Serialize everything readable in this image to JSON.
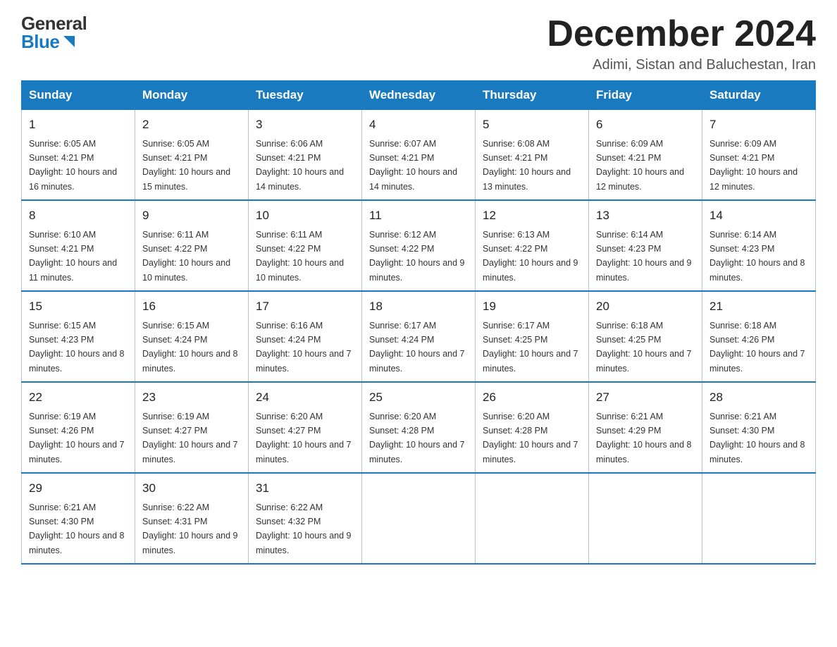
{
  "header": {
    "logo_general": "General",
    "logo_blue": "Blue",
    "month_title": "December 2024",
    "subtitle": "Adimi, Sistan and Baluchestan, Iran"
  },
  "days_of_week": [
    "Sunday",
    "Monday",
    "Tuesday",
    "Wednesday",
    "Thursday",
    "Friday",
    "Saturday"
  ],
  "weeks": [
    [
      {
        "day": "1",
        "sunrise": "6:05 AM",
        "sunset": "4:21 PM",
        "daylight": "10 hours and 16 minutes."
      },
      {
        "day": "2",
        "sunrise": "6:05 AM",
        "sunset": "4:21 PM",
        "daylight": "10 hours and 15 minutes."
      },
      {
        "day": "3",
        "sunrise": "6:06 AM",
        "sunset": "4:21 PM",
        "daylight": "10 hours and 14 minutes."
      },
      {
        "day": "4",
        "sunrise": "6:07 AM",
        "sunset": "4:21 PM",
        "daylight": "10 hours and 14 minutes."
      },
      {
        "day": "5",
        "sunrise": "6:08 AM",
        "sunset": "4:21 PM",
        "daylight": "10 hours and 13 minutes."
      },
      {
        "day": "6",
        "sunrise": "6:09 AM",
        "sunset": "4:21 PM",
        "daylight": "10 hours and 12 minutes."
      },
      {
        "day": "7",
        "sunrise": "6:09 AM",
        "sunset": "4:21 PM",
        "daylight": "10 hours and 12 minutes."
      }
    ],
    [
      {
        "day": "8",
        "sunrise": "6:10 AM",
        "sunset": "4:21 PM",
        "daylight": "10 hours and 11 minutes."
      },
      {
        "day": "9",
        "sunrise": "6:11 AM",
        "sunset": "4:22 PM",
        "daylight": "10 hours and 10 minutes."
      },
      {
        "day": "10",
        "sunrise": "6:11 AM",
        "sunset": "4:22 PM",
        "daylight": "10 hours and 10 minutes."
      },
      {
        "day": "11",
        "sunrise": "6:12 AM",
        "sunset": "4:22 PM",
        "daylight": "10 hours and 9 minutes."
      },
      {
        "day": "12",
        "sunrise": "6:13 AM",
        "sunset": "4:22 PM",
        "daylight": "10 hours and 9 minutes."
      },
      {
        "day": "13",
        "sunrise": "6:14 AM",
        "sunset": "4:23 PM",
        "daylight": "10 hours and 9 minutes."
      },
      {
        "day": "14",
        "sunrise": "6:14 AM",
        "sunset": "4:23 PM",
        "daylight": "10 hours and 8 minutes."
      }
    ],
    [
      {
        "day": "15",
        "sunrise": "6:15 AM",
        "sunset": "4:23 PM",
        "daylight": "10 hours and 8 minutes."
      },
      {
        "day": "16",
        "sunrise": "6:15 AM",
        "sunset": "4:24 PM",
        "daylight": "10 hours and 8 minutes."
      },
      {
        "day": "17",
        "sunrise": "6:16 AM",
        "sunset": "4:24 PM",
        "daylight": "10 hours and 7 minutes."
      },
      {
        "day": "18",
        "sunrise": "6:17 AM",
        "sunset": "4:24 PM",
        "daylight": "10 hours and 7 minutes."
      },
      {
        "day": "19",
        "sunrise": "6:17 AM",
        "sunset": "4:25 PM",
        "daylight": "10 hours and 7 minutes."
      },
      {
        "day": "20",
        "sunrise": "6:18 AM",
        "sunset": "4:25 PM",
        "daylight": "10 hours and 7 minutes."
      },
      {
        "day": "21",
        "sunrise": "6:18 AM",
        "sunset": "4:26 PM",
        "daylight": "10 hours and 7 minutes."
      }
    ],
    [
      {
        "day": "22",
        "sunrise": "6:19 AM",
        "sunset": "4:26 PM",
        "daylight": "10 hours and 7 minutes."
      },
      {
        "day": "23",
        "sunrise": "6:19 AM",
        "sunset": "4:27 PM",
        "daylight": "10 hours and 7 minutes."
      },
      {
        "day": "24",
        "sunrise": "6:20 AM",
        "sunset": "4:27 PM",
        "daylight": "10 hours and 7 minutes."
      },
      {
        "day": "25",
        "sunrise": "6:20 AM",
        "sunset": "4:28 PM",
        "daylight": "10 hours and 7 minutes."
      },
      {
        "day": "26",
        "sunrise": "6:20 AM",
        "sunset": "4:28 PM",
        "daylight": "10 hours and 7 minutes."
      },
      {
        "day": "27",
        "sunrise": "6:21 AM",
        "sunset": "4:29 PM",
        "daylight": "10 hours and 8 minutes."
      },
      {
        "day": "28",
        "sunrise": "6:21 AM",
        "sunset": "4:30 PM",
        "daylight": "10 hours and 8 minutes."
      }
    ],
    [
      {
        "day": "29",
        "sunrise": "6:21 AM",
        "sunset": "4:30 PM",
        "daylight": "10 hours and 8 minutes."
      },
      {
        "day": "30",
        "sunrise": "6:22 AM",
        "sunset": "4:31 PM",
        "daylight": "10 hours and 9 minutes."
      },
      {
        "day": "31",
        "sunrise": "6:22 AM",
        "sunset": "4:32 PM",
        "daylight": "10 hours and 9 minutes."
      },
      null,
      null,
      null,
      null
    ]
  ],
  "labels": {
    "sunrise": "Sunrise:",
    "sunset": "Sunset:",
    "daylight": "Daylight:"
  }
}
